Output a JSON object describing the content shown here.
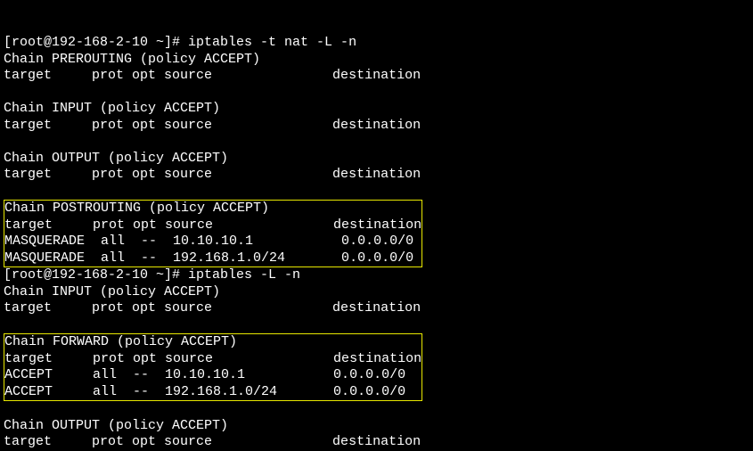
{
  "prompt1": "[root@192-168-2-10 ~]# iptables -t nat -L -n",
  "nat": {
    "prerouting": {
      "header": "Chain PREROUTING (policy ACCEPT)",
      "cols": "target     prot opt source               destination"
    },
    "input": {
      "header": "Chain INPUT (policy ACCEPT)",
      "cols": "target     prot opt source               destination"
    },
    "output": {
      "header": "Chain OUTPUT (policy ACCEPT)",
      "cols": "target     prot opt source               destination"
    },
    "postrouting": {
      "header": "Chain POSTROUTING (policy ACCEPT)",
      "cols": "target     prot opt source               destination",
      "r1": "MASQUERADE  all  --  10.10.10.1           0.0.0.0/0",
      "r2": "MASQUERADE  all  --  192.168.1.0/24       0.0.0.0/0"
    }
  },
  "prompt2": "[root@192-168-2-10 ~]# iptables -L -n",
  "filter": {
    "input": {
      "header": "Chain INPUT (policy ACCEPT)",
      "cols": "target     prot opt source               destination"
    },
    "forward": {
      "header": "Chain FORWARD (policy ACCEPT)",
      "cols": "target     prot opt source               destination",
      "r1": "ACCEPT     all  --  10.10.10.1           0.0.0.0/0",
      "r2": "ACCEPT     all  --  192.168.1.0/24       0.0.0.0/0"
    },
    "output": {
      "header": "Chain OUTPUT (policy ACCEPT)",
      "cols": "target     prot opt source               destination"
    }
  }
}
